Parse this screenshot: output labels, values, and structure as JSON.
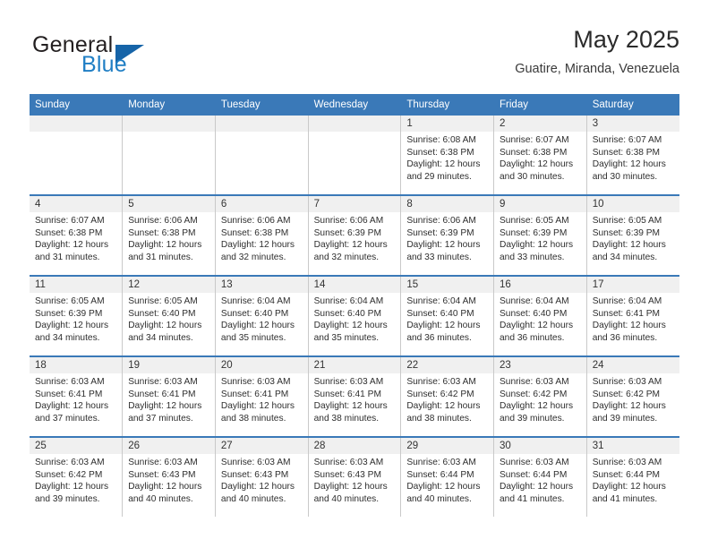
{
  "brand": {
    "name_part1": "General",
    "name_part2": "Blue",
    "triangle_color": "#1664a8",
    "blue_color": "#1f7ec4"
  },
  "header": {
    "title": "May 2025",
    "location": "Guatire, Miranda, Venezuela"
  },
  "theme": {
    "header_row_bg": "#3a79b8",
    "day_strip_bg": "#f0f0f0",
    "row_divider": "#3a79b8",
    "cell_border": "#c9c9c9"
  },
  "calendar": {
    "weekdays": [
      "Sunday",
      "Monday",
      "Tuesday",
      "Wednesday",
      "Thursday",
      "Friday",
      "Saturday"
    ],
    "weeks": [
      [
        {
          "day": "",
          "sunrise": "",
          "sunset": "",
          "daylight1": "",
          "daylight2": ""
        },
        {
          "day": "",
          "sunrise": "",
          "sunset": "",
          "daylight1": "",
          "daylight2": ""
        },
        {
          "day": "",
          "sunrise": "",
          "sunset": "",
          "daylight1": "",
          "daylight2": ""
        },
        {
          "day": "",
          "sunrise": "",
          "sunset": "",
          "daylight1": "",
          "daylight2": ""
        },
        {
          "day": "1",
          "sunrise": "Sunrise: 6:08 AM",
          "sunset": "Sunset: 6:38 PM",
          "daylight1": "Daylight: 12 hours",
          "daylight2": "and 29 minutes."
        },
        {
          "day": "2",
          "sunrise": "Sunrise: 6:07 AM",
          "sunset": "Sunset: 6:38 PM",
          "daylight1": "Daylight: 12 hours",
          "daylight2": "and 30 minutes."
        },
        {
          "day": "3",
          "sunrise": "Sunrise: 6:07 AM",
          "sunset": "Sunset: 6:38 PM",
          "daylight1": "Daylight: 12 hours",
          "daylight2": "and 30 minutes."
        }
      ],
      [
        {
          "day": "4",
          "sunrise": "Sunrise: 6:07 AM",
          "sunset": "Sunset: 6:38 PM",
          "daylight1": "Daylight: 12 hours",
          "daylight2": "and 31 minutes."
        },
        {
          "day": "5",
          "sunrise": "Sunrise: 6:06 AM",
          "sunset": "Sunset: 6:38 PM",
          "daylight1": "Daylight: 12 hours",
          "daylight2": "and 31 minutes."
        },
        {
          "day": "6",
          "sunrise": "Sunrise: 6:06 AM",
          "sunset": "Sunset: 6:38 PM",
          "daylight1": "Daylight: 12 hours",
          "daylight2": "and 32 minutes."
        },
        {
          "day": "7",
          "sunrise": "Sunrise: 6:06 AM",
          "sunset": "Sunset: 6:39 PM",
          "daylight1": "Daylight: 12 hours",
          "daylight2": "and 32 minutes."
        },
        {
          "day": "8",
          "sunrise": "Sunrise: 6:06 AM",
          "sunset": "Sunset: 6:39 PM",
          "daylight1": "Daylight: 12 hours",
          "daylight2": "and 33 minutes."
        },
        {
          "day": "9",
          "sunrise": "Sunrise: 6:05 AM",
          "sunset": "Sunset: 6:39 PM",
          "daylight1": "Daylight: 12 hours",
          "daylight2": "and 33 minutes."
        },
        {
          "day": "10",
          "sunrise": "Sunrise: 6:05 AM",
          "sunset": "Sunset: 6:39 PM",
          "daylight1": "Daylight: 12 hours",
          "daylight2": "and 34 minutes."
        }
      ],
      [
        {
          "day": "11",
          "sunrise": "Sunrise: 6:05 AM",
          "sunset": "Sunset: 6:39 PM",
          "daylight1": "Daylight: 12 hours",
          "daylight2": "and 34 minutes."
        },
        {
          "day": "12",
          "sunrise": "Sunrise: 6:05 AM",
          "sunset": "Sunset: 6:40 PM",
          "daylight1": "Daylight: 12 hours",
          "daylight2": "and 34 minutes."
        },
        {
          "day": "13",
          "sunrise": "Sunrise: 6:04 AM",
          "sunset": "Sunset: 6:40 PM",
          "daylight1": "Daylight: 12 hours",
          "daylight2": "and 35 minutes."
        },
        {
          "day": "14",
          "sunrise": "Sunrise: 6:04 AM",
          "sunset": "Sunset: 6:40 PM",
          "daylight1": "Daylight: 12 hours",
          "daylight2": "and 35 minutes."
        },
        {
          "day": "15",
          "sunrise": "Sunrise: 6:04 AM",
          "sunset": "Sunset: 6:40 PM",
          "daylight1": "Daylight: 12 hours",
          "daylight2": "and 36 minutes."
        },
        {
          "day": "16",
          "sunrise": "Sunrise: 6:04 AM",
          "sunset": "Sunset: 6:40 PM",
          "daylight1": "Daylight: 12 hours",
          "daylight2": "and 36 minutes."
        },
        {
          "day": "17",
          "sunrise": "Sunrise: 6:04 AM",
          "sunset": "Sunset: 6:41 PM",
          "daylight1": "Daylight: 12 hours",
          "daylight2": "and 36 minutes."
        }
      ],
      [
        {
          "day": "18",
          "sunrise": "Sunrise: 6:03 AM",
          "sunset": "Sunset: 6:41 PM",
          "daylight1": "Daylight: 12 hours",
          "daylight2": "and 37 minutes."
        },
        {
          "day": "19",
          "sunrise": "Sunrise: 6:03 AM",
          "sunset": "Sunset: 6:41 PM",
          "daylight1": "Daylight: 12 hours",
          "daylight2": "and 37 minutes."
        },
        {
          "day": "20",
          "sunrise": "Sunrise: 6:03 AM",
          "sunset": "Sunset: 6:41 PM",
          "daylight1": "Daylight: 12 hours",
          "daylight2": "and 38 minutes."
        },
        {
          "day": "21",
          "sunrise": "Sunrise: 6:03 AM",
          "sunset": "Sunset: 6:41 PM",
          "daylight1": "Daylight: 12 hours",
          "daylight2": "and 38 minutes."
        },
        {
          "day": "22",
          "sunrise": "Sunrise: 6:03 AM",
          "sunset": "Sunset: 6:42 PM",
          "daylight1": "Daylight: 12 hours",
          "daylight2": "and 38 minutes."
        },
        {
          "day": "23",
          "sunrise": "Sunrise: 6:03 AM",
          "sunset": "Sunset: 6:42 PM",
          "daylight1": "Daylight: 12 hours",
          "daylight2": "and 39 minutes."
        },
        {
          "day": "24",
          "sunrise": "Sunrise: 6:03 AM",
          "sunset": "Sunset: 6:42 PM",
          "daylight1": "Daylight: 12 hours",
          "daylight2": "and 39 minutes."
        }
      ],
      [
        {
          "day": "25",
          "sunrise": "Sunrise: 6:03 AM",
          "sunset": "Sunset: 6:42 PM",
          "daylight1": "Daylight: 12 hours",
          "daylight2": "and 39 minutes."
        },
        {
          "day": "26",
          "sunrise": "Sunrise: 6:03 AM",
          "sunset": "Sunset: 6:43 PM",
          "daylight1": "Daylight: 12 hours",
          "daylight2": "and 40 minutes."
        },
        {
          "day": "27",
          "sunrise": "Sunrise: 6:03 AM",
          "sunset": "Sunset: 6:43 PM",
          "daylight1": "Daylight: 12 hours",
          "daylight2": "and 40 minutes."
        },
        {
          "day": "28",
          "sunrise": "Sunrise: 6:03 AM",
          "sunset": "Sunset: 6:43 PM",
          "daylight1": "Daylight: 12 hours",
          "daylight2": "and 40 minutes."
        },
        {
          "day": "29",
          "sunrise": "Sunrise: 6:03 AM",
          "sunset": "Sunset: 6:44 PM",
          "daylight1": "Daylight: 12 hours",
          "daylight2": "and 40 minutes."
        },
        {
          "day": "30",
          "sunrise": "Sunrise: 6:03 AM",
          "sunset": "Sunset: 6:44 PM",
          "daylight1": "Daylight: 12 hours",
          "daylight2": "and 41 minutes."
        },
        {
          "day": "31",
          "sunrise": "Sunrise: 6:03 AM",
          "sunset": "Sunset: 6:44 PM",
          "daylight1": "Daylight: 12 hours",
          "daylight2": "and 41 minutes."
        }
      ]
    ]
  }
}
